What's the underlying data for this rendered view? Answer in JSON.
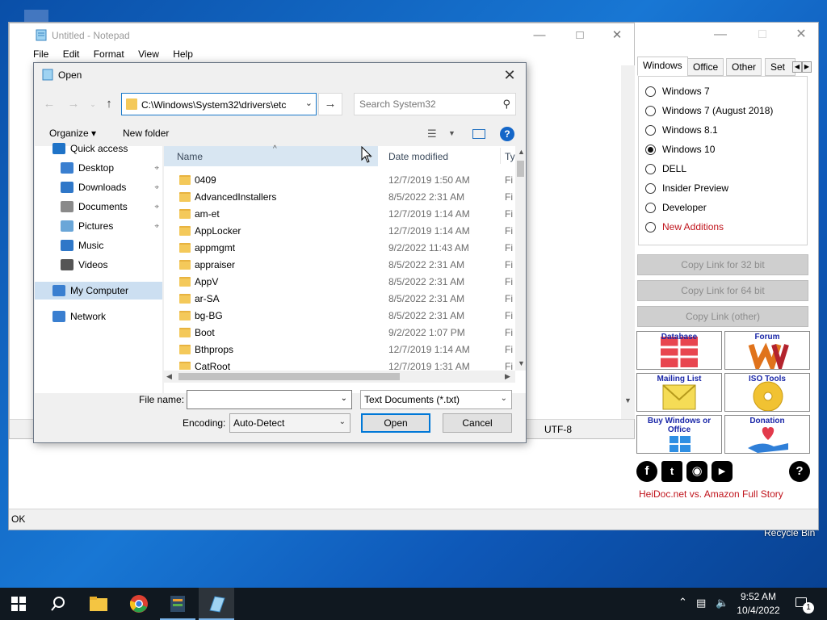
{
  "notepad": {
    "title": "Untitled - Notepad",
    "menu": [
      "File",
      "Edit",
      "Format",
      "View",
      "Help"
    ],
    "status_encoding": "UTF-8"
  },
  "open_dialog": {
    "title": "Open",
    "address_path": "C:\\Windows\\System32\\drivers\\etc",
    "search_placeholder": "Search System32",
    "organize_label": "Organize",
    "new_folder_label": "New folder",
    "nav_items": [
      {
        "label": "Quick access",
        "icon": "star-icon"
      },
      {
        "label": "Desktop",
        "icon": "desktop-icon"
      },
      {
        "label": "Downloads",
        "icon": "download-icon"
      },
      {
        "label": "Documents",
        "icon": "documents-icon"
      },
      {
        "label": "Pictures",
        "icon": "pictures-icon"
      },
      {
        "label": "Music",
        "icon": "music-icon"
      },
      {
        "label": "Videos",
        "icon": "videos-icon"
      },
      {
        "label": "My Computer",
        "icon": "computer-icon"
      },
      {
        "label": "Network",
        "icon": "network-icon"
      }
    ],
    "columns": {
      "name": "Name",
      "date": "Date modified",
      "type": "Ty"
    },
    "files": [
      {
        "name": "0409",
        "date": "12/7/2019 1:50 AM",
        "type": "Fi"
      },
      {
        "name": "AdvancedInstallers",
        "date": "8/5/2022 2:31 AM",
        "type": "Fi"
      },
      {
        "name": "am-et",
        "date": "12/7/2019 1:14 AM",
        "type": "Fi"
      },
      {
        "name": "AppLocker",
        "date": "12/7/2019 1:14 AM",
        "type": "Fi"
      },
      {
        "name": "appmgmt",
        "date": "9/2/2022 11:43 AM",
        "type": "Fi"
      },
      {
        "name": "appraiser",
        "date": "8/5/2022 2:31 AM",
        "type": "Fi"
      },
      {
        "name": "AppV",
        "date": "8/5/2022 2:31 AM",
        "type": "Fi"
      },
      {
        "name": "ar-SA",
        "date": "8/5/2022 2:31 AM",
        "type": "Fi"
      },
      {
        "name": "bg-BG",
        "date": "8/5/2022 2:31 AM",
        "type": "Fi"
      },
      {
        "name": "Boot",
        "date": "9/2/2022 1:07 PM",
        "type": "Fi"
      },
      {
        "name": "Bthprops",
        "date": "12/7/2019 1:14 AM",
        "type": "Fi"
      },
      {
        "name": "CatRoot",
        "date": "12/7/2019 1:31 AM",
        "type": "Fi"
      }
    ],
    "file_name_label": "File name:",
    "file_name_value": "",
    "file_type": "Text Documents (*.txt)",
    "encoding_label": "Encoding:",
    "encoding_value": "Auto-Detect",
    "open_button": "Open",
    "cancel_button": "Cancel"
  },
  "heidoc": {
    "tabs": [
      "Windows",
      "Office",
      "Other",
      "Set"
    ],
    "options": [
      {
        "label": "Windows 7",
        "checked": false,
        "red": false
      },
      {
        "label": "Windows 7 (August 2018)",
        "checked": false,
        "red": false
      },
      {
        "label": "Windows 8.1",
        "checked": false,
        "red": false
      },
      {
        "label": "Windows 10",
        "checked": true,
        "red": false
      },
      {
        "label": "DELL",
        "checked": false,
        "red": false
      },
      {
        "label": "Insider Preview",
        "checked": false,
        "red": false
      },
      {
        "label": "Developer",
        "checked": false,
        "red": false
      },
      {
        "label": "New Additions",
        "checked": false,
        "red": true
      }
    ],
    "copy_buttons": [
      "Copy Link for 32 bit",
      "Copy Link for 64 bit",
      "Copy Link (other)"
    ],
    "tiles": [
      "Database",
      "Forum",
      "Mailing List",
      "ISO Tools",
      "Buy Windows or Office",
      "Donation"
    ],
    "link_text": "HeiDoc.net vs. Amazon Full Story",
    "status": "OK"
  },
  "desktop": {
    "recycle_bin": "Recycle Bin"
  },
  "taskbar": {
    "time": "9:52 AM",
    "date": "10/4/2022",
    "notification_count": "1"
  },
  "colors": {
    "accent": "#0078d7",
    "red_text": "#c0141c",
    "taskbar": "#101820"
  }
}
